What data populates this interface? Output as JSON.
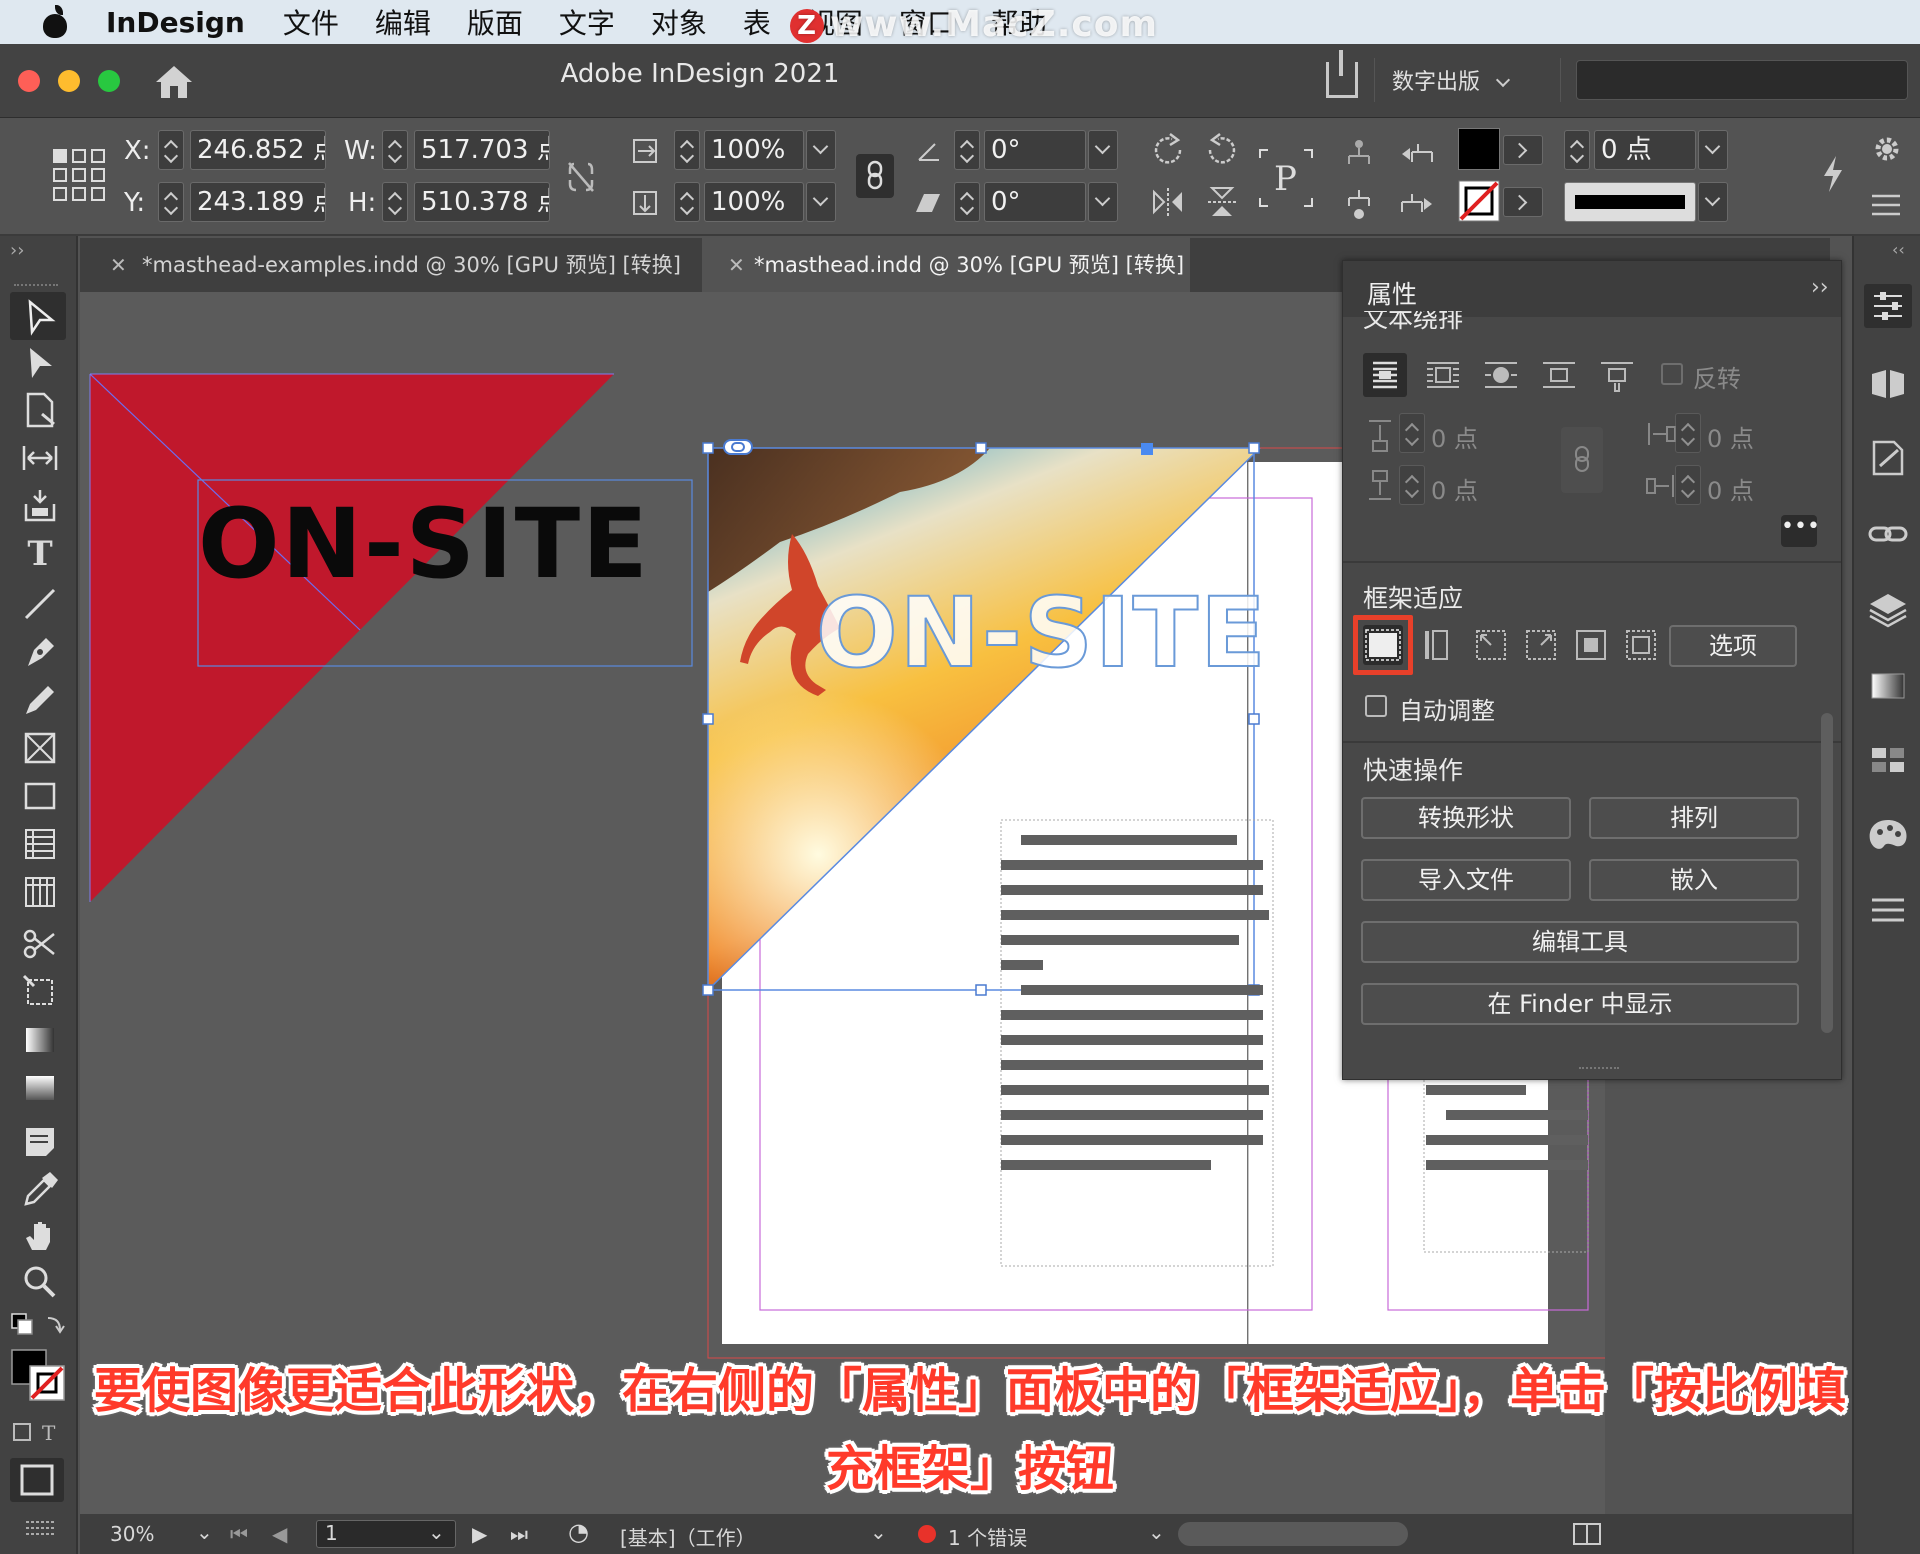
{
  "menubar": {
    "app_name": "InDesign",
    "items": [
      "文件",
      "编辑",
      "版面",
      "文字",
      "对象",
      "表",
      "视图",
      "窗口",
      "帮助"
    ],
    "watermark": "www.MacZ.com",
    "watermark_badge": "Z"
  },
  "titlebar": {
    "title": "Adobe InDesign 2021",
    "workspace": "数字出版",
    "icons": [
      "home-icon",
      "share-icon"
    ]
  },
  "control": {
    "x_label": "X:",
    "x_value": "246.852 点",
    "y_label": "Y:",
    "y_value": "243.189 点",
    "w_label": "W:",
    "w_value": "517.703 点",
    "h_label": "H:",
    "h_value": "510.378 点",
    "scale_x": "100%",
    "scale_y": "100%",
    "rotate": "0°",
    "shear": "0°",
    "stroke_weight": "0 点"
  },
  "tabs": [
    {
      "label": "*masthead-examples.indd @ 30% [GPU 预览] [转换]",
      "active": false
    },
    {
      "label": "*masthead.indd @ 30% [GPU 预览] [转换]",
      "active": true
    }
  ],
  "canvas": {
    "headline_left": "ON-SITE",
    "headline_right": "ON-SITE",
    "accent_red": "#c0182c"
  },
  "props": {
    "title": "属性",
    "text_wrap": "文本绕排",
    "invert": "反转",
    "offset_top": "0 点",
    "offset_bottom": "0 点",
    "offset_left": "0 点",
    "offset_right": "0 点",
    "frame_fitting": "框架适应",
    "options_button": "选项",
    "auto_fit": "自动调整",
    "quick_actions": "快速操作",
    "btn_convert_shape": "转换形状",
    "btn_arrange": "排列",
    "btn_import_file": "导入文件",
    "btn_embed": "嵌入",
    "btn_edit_tool": "编辑工具",
    "btn_show_finder": "在 Finder 中显示"
  },
  "status": {
    "zoom": "30%",
    "page": "1",
    "preflight_profile": "[基本]（工作）",
    "errors": "1 个错误"
  },
  "caption": "要使图像更适合此形状，在右侧的「属性」面板中的「框架适应」，单击「按比例填充框架」按钮"
}
